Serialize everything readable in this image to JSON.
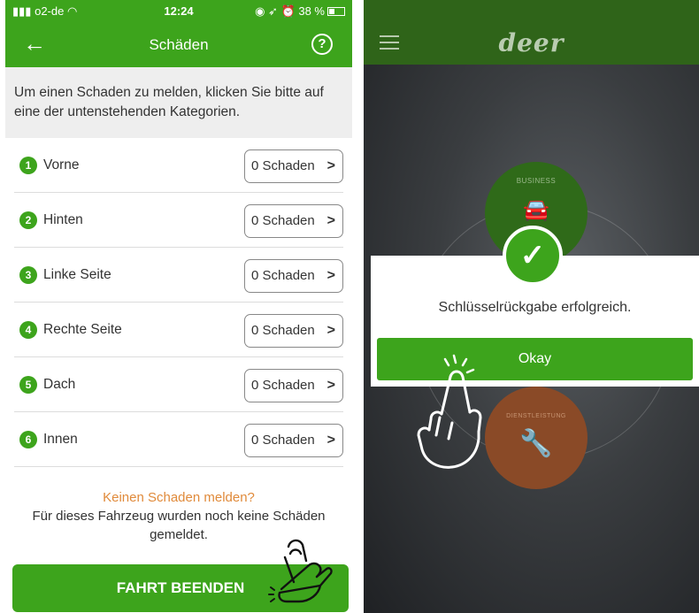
{
  "left_screen": {
    "status_bar": {
      "carrier": "o2-de",
      "time": "12:24",
      "battery": "38 %"
    },
    "app_bar": {
      "title": "Schäden"
    },
    "intro_text": "Um einen Schaden zu melden, klicken Sie bitte auf eine der untenstehenden Kategorien.",
    "categories": [
      {
        "number": "1",
        "label": "Vorne",
        "damage_count": "0 Schaden"
      },
      {
        "number": "2",
        "label": "Hinten",
        "damage_count": "0 Schaden"
      },
      {
        "number": "3",
        "label": "Linke Seite",
        "damage_count": "0 Schaden"
      },
      {
        "number": "4",
        "label": "Rechte Seite",
        "damage_count": "0 Schaden"
      },
      {
        "number": "5",
        "label": "Dach",
        "damage_count": "0 Schaden"
      },
      {
        "number": "6",
        "label": "Innen",
        "damage_count": "0 Schaden"
      }
    ],
    "no_damage_link": "Keinen Schaden melden?",
    "no_damage_text": "Für dieses Fahrzeug wurden noch keine Schäden gemeldet.",
    "end_trip_button": "FAHRT BEENDEN"
  },
  "right_screen": {
    "logo": "deer",
    "business_label": "BUSINESS",
    "service_label": "DIENSTLEISTUNG",
    "dialog": {
      "message": "Schlüsselrückgabe erfolgreich.",
      "ok_button": "Okay"
    }
  },
  "colors": {
    "brand_green": "#3da41c",
    "dark_green": "#2f6419",
    "link_orange": "#e08a3a",
    "service_brown": "#8a4a27"
  },
  "icons": [
    "back-arrow-icon",
    "help-icon",
    "chevron-right-icon",
    "menu-icon",
    "checkmark-icon",
    "car-icon",
    "wrench-icon",
    "pointing-hand-icon"
  ]
}
